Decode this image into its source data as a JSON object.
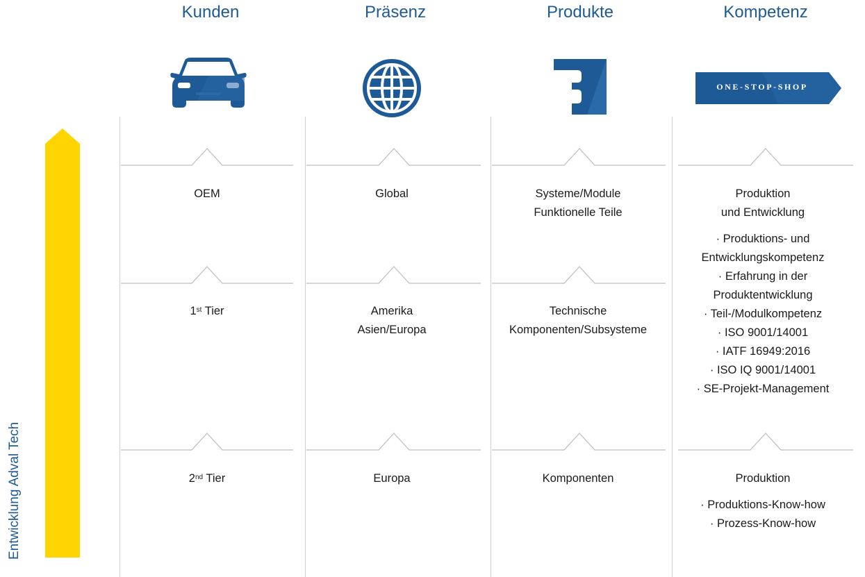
{
  "columns": [
    {
      "title": "Kunden",
      "icon": "car-icon"
    },
    {
      "title": "Präsenz",
      "icon": "globe-icon"
    },
    {
      "title": "Produkte",
      "icon": "puzzle-piece-icon"
    },
    {
      "title": "Kompetenz",
      "icon": "one-stop-shop-banner-icon"
    }
  ],
  "banner_text": "ONE-STOP-SHOP",
  "side_label": "Entwicklung Adval Tech",
  "colors": {
    "accent_blue": "#1e5a96",
    "arrow_yellow": "#ffd500",
    "lines": "#bdbdbd"
  },
  "rows": {
    "top": {
      "kunden": "OEM",
      "praesenz": "Global",
      "produkte": [
        "Systeme/Module",
        "Funktionelle Teile"
      ],
      "kompetenz_head": [
        "Produktion",
        "und Entwicklung"
      ],
      "kompetenz_list": [
        "· Produktions- und",
        "Entwicklungskompetenz",
        "· Erfahrung in der",
        "Produktentwicklung",
        "· Teil-/Modulkompetenz",
        "· ISO 9001/14001",
        "· IATF 16949:2016",
        "· ISO IQ 9001/14001",
        "· SE-Projekt-Management"
      ]
    },
    "middle": {
      "kunden_num": "1",
      "kunden_sup": "st",
      "kunden_rest": " Tier",
      "praesenz": [
        "Amerika",
        "Asien/Europa"
      ],
      "produkte": [
        "Technische",
        "Komponenten/Subsysteme"
      ]
    },
    "bottom": {
      "kunden_num": "2",
      "kunden_sup": "nd",
      "kunden_rest": " Tier",
      "praesenz": "Europa",
      "produkte": "Komponenten",
      "kompetenz_head": "Produktion",
      "kompetenz_list": [
        "· Produktions-Know-how",
        "· Prozess-Know-how"
      ]
    }
  }
}
